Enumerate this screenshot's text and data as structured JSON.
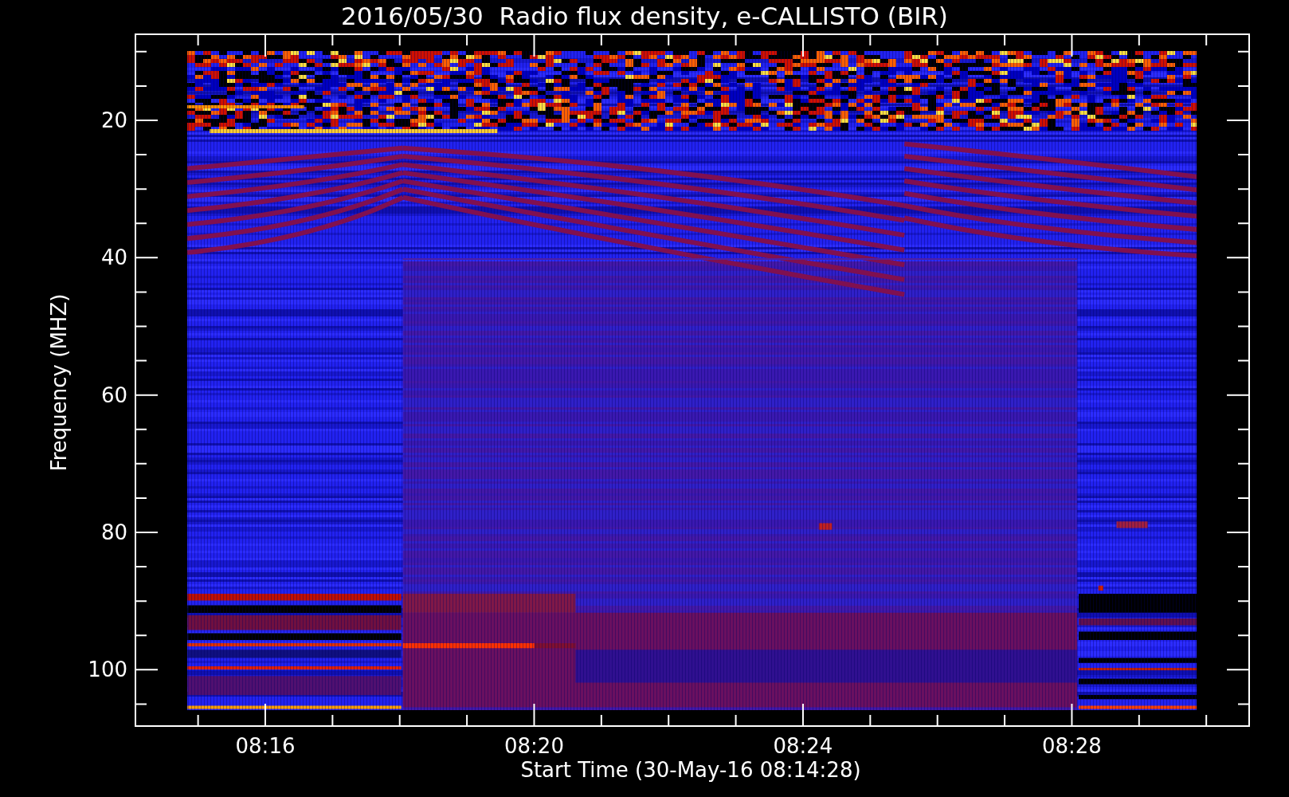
{
  "title": "2016/05/30  Radio flux density, e-CALLISTO (BIR)",
  "x_axis": {
    "label": "Start Time (30-May-16 08:14:28)",
    "ticks": [
      "08:16",
      "08:20",
      "08:24",
      "08:28"
    ]
  },
  "y_axis": {
    "label": "Frequency (MHZ)",
    "ticks": [
      "20",
      "40",
      "60",
      "80",
      "100"
    ]
  }
}
